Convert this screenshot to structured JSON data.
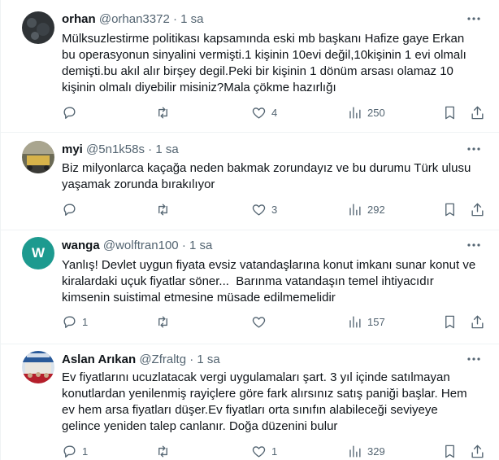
{
  "tweets": [
    {
      "name": "orhan",
      "handle": "@orhan3372",
      "dot": "·",
      "time": "1 sa",
      "avatar": "avatar-dark-pattern",
      "text": "Mülksuzlestirme politikası kapsamında eski mb başkanı Hafize gaye Erkan bu operasyonun sinyalini vermişti.1 kişinin 10evi değil,10kişinin 1 evi olmalı demişti.bu akıl alır birşey degil.Peki bir kişinin 1 dönüm arsası olamaz 10 kişinin olmalı diyebilir misiniz?Mala çökme hazırlığı",
      "replies": "",
      "retweets": "",
      "likes": "4",
      "views": "250"
    },
    {
      "name": "myi",
      "handle": "@5n1k58s",
      "dot": "·",
      "time": "1 sa",
      "avatar": "avatar-photo",
      "text": "Biz milyonlarca kaçağa neden bakmak zorundayız ve bu durumu Türk ulusu yaşamak zorunda bırakılıyor",
      "replies": "",
      "retweets": "",
      "likes": "3",
      "views": "292"
    },
    {
      "name": "wanga",
      "handle": "@wolftran100",
      "dot": "·",
      "time": "1 sa",
      "avatar_letter": "W",
      "avatar": "avatar-letter-w",
      "text": "Yanlış! Devlet uygun fiyata evsiz vatandaşlarına konut imkanı sunar konut ve kiralardaki uçuk fiyatlar söner...  Barınma vatandaşın temel ihtiyacıdır kimsenin suistimal etmesine müsade edilmemelidir",
      "replies": "1",
      "retweets": "",
      "likes": "",
      "views": "157"
    },
    {
      "name": "Aslan Arıkan",
      "handle": "@Zfraltg",
      "dot": "·",
      "time": "1 sa",
      "avatar": "avatar-photo-crowd",
      "text": "Ev fiyatlarını ucuzlatacak vergi uygulamaları şart. 3 yıl içinde satılmayan konutlardan yenilenmiş rayiçlere göre fark alırsınız satış paniği başlar. Hem ev hem arsa fiyatları düşer.Ev fiyatları orta sınıfın alabileceği seviyeye gelince yeniden talep canlanır. Doğa düzenini bulur",
      "replies": "1",
      "retweets": "",
      "likes": "1",
      "views": "329"
    }
  ],
  "colors": {
    "text": "#0f1419",
    "secondary": "#536471",
    "border": "#eff3f4",
    "wanga_avatar": "#1d9a8f"
  }
}
